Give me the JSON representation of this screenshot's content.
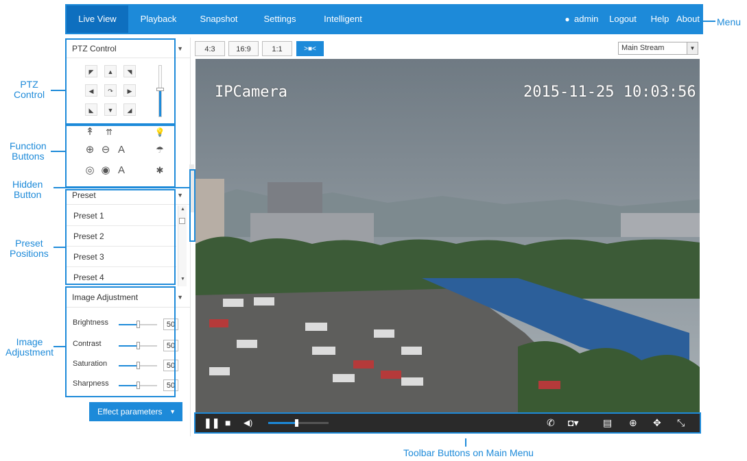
{
  "menu": {
    "items": [
      "Live View",
      "Playback",
      "Snapshot",
      "Settings",
      "Intelligent"
    ],
    "active": "Live View",
    "user": "admin",
    "logout": "Logout",
    "help": "Help",
    "about": "About"
  },
  "callouts": {
    "menu": "Menu",
    "ptz_control": "PTZ\nControl",
    "function_buttons": "Function\nButtons",
    "hidden_button": "Hidden\nButton",
    "preset_positions": "Preset\nPositions",
    "image_adjustment": "Image\nAdjustment",
    "toolbar": "Toolbar Buttons on Main Menu"
  },
  "ptz": {
    "title": "PTZ Control",
    "arrows": [
      "◤",
      "▲",
      "◥",
      "◀",
      "↷",
      "▶",
      "◣",
      "▼",
      "◢"
    ]
  },
  "functions": {
    "row1": [
      "↟",
      "⇈",
      "💡"
    ],
    "row2": [
      "⊕",
      "⊖",
      "A",
      "☂"
    ],
    "row3": [
      "◎",
      "◉",
      "A",
      "✱"
    ]
  },
  "preset": {
    "title": "Preset",
    "items": [
      "Preset 1",
      "Preset 2",
      "Preset 3",
      "Preset 4"
    ]
  },
  "image_adjustment": {
    "title": "Image Adjustment",
    "sliders": [
      {
        "label": "Brightness",
        "value": "50"
      },
      {
        "label": "Contrast",
        "value": "50"
      },
      {
        "label": "Saturation",
        "value": "50"
      },
      {
        "label": "Sharpness",
        "value": "50"
      }
    ],
    "effect_button": "Effect parameters"
  },
  "view_toolbar": {
    "ratios": [
      "4:3",
      "16:9",
      "1:1"
    ],
    "stream": "Main Stream"
  },
  "video": {
    "overlay_name": "IPCamera",
    "overlay_time": "2015-11-25 10:03:56"
  },
  "controlbar": {
    "volume_fraction": 0.47,
    "icons": [
      "pause-icon",
      "stop-icon",
      "volume-icon",
      "phone-icon",
      "camera-icon",
      "record-icon",
      "zoom-icon",
      "ptz-move-icon",
      "fullscreen-icon"
    ]
  },
  "colors": {
    "accent": "#1d8ad9",
    "accent_dark": "#0e6fbf",
    "controlbar": "#2a2a2a"
  }
}
